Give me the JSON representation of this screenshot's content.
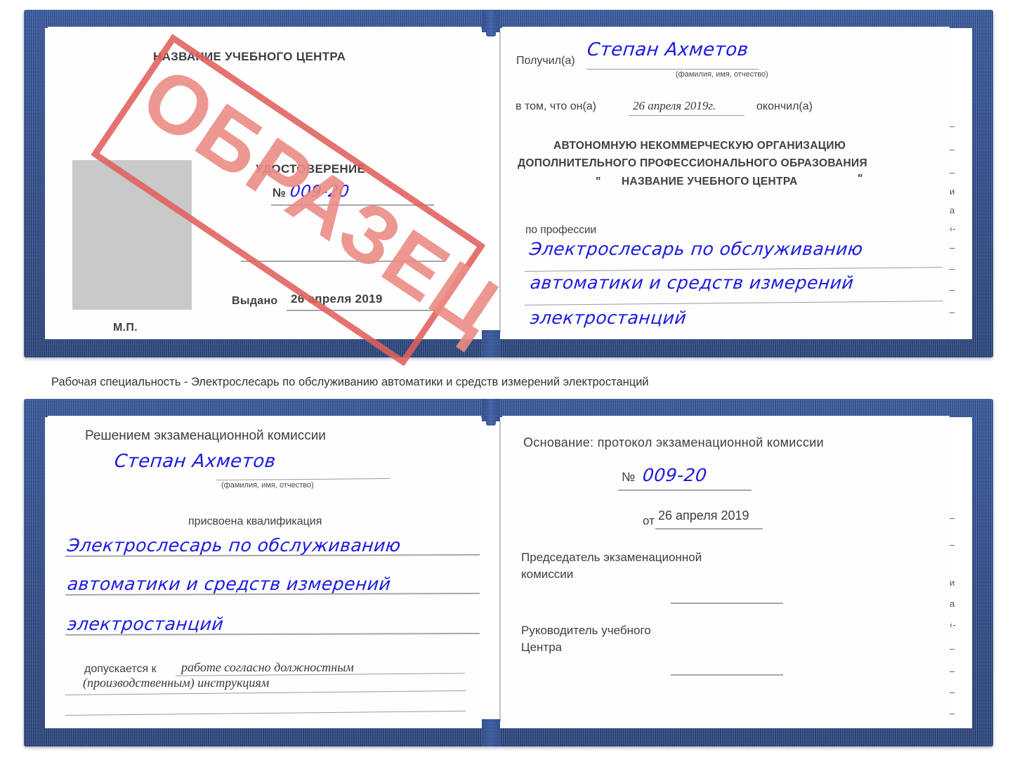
{
  "document": {
    "type": "certificate",
    "language": "ru",
    "colors": {
      "cover_blue": "#2b4a8c",
      "stamp_red": "#e0605c",
      "handwriting_blue": "#1a1ae0",
      "photo_placeholder_grey": "#c9c9c9",
      "rule_grey": "#9b9b9b"
    }
  },
  "stamp": {
    "text": "ОБРАЗЕЦ"
  },
  "cert_top": {
    "left_page": {
      "org_title": "НАЗВАНИЕ УЧЕБНОГО ЦЕНТРА",
      "doc_kind": "УДОСТОВЕРЕНИЕ",
      "number_label": "№",
      "number_value": "009-20",
      "issued_label": "Выдано",
      "issued_value": "26 апреля 2019",
      "seal_label": "М.П."
    },
    "right_page": {
      "received_label": "Получил(а)",
      "received_value": "Степан Ахметов",
      "name_hint": "(фамилия, имя, отчество)",
      "in_that_label": "в том, что он(а)",
      "in_that_value": "26 апреля 2019г.",
      "finished_label": "окончил(а)",
      "org_line1": "АВТОНОМНУЮ НЕКОММЕРЧЕСКУЮ ОРГАНИЗАЦИЮ",
      "org_line2": "ДОПОЛНИТЕЛЬНОГО ПРОФЕССИОНАЛЬНОГО ОБРАЗОВАНИЯ",
      "org_quote_open": "\"",
      "org_line3": "НАЗВАНИЕ УЧЕБНОГО ЦЕНТРА",
      "org_quote_close": "\"",
      "profession_label": "по профессии",
      "profession_line1": "Электрослесарь по обслуживанию",
      "profession_line2": "автоматики и средств измерений",
      "profession_line3": "электростанций"
    }
  },
  "caption": {
    "text": "Рабочая специальность - Электрослесарь по обслуживанию автоматики и средств измерений электростанций"
  },
  "cert_bottom": {
    "left_page": {
      "decision_label": "Решением экзаменационной комиссии",
      "name_value": "Степан Ахметов",
      "name_hint": "(фамилия, имя, отчество)",
      "qualification_label": "присвоена квалификация",
      "qualification_line1": "Электрослесарь по обслуживанию",
      "qualification_line2": "автоматики и средств измерений",
      "qualification_line3": "электростанций",
      "allowed_label": "допускается к",
      "allowed_value_line1": "работе согласно должностным",
      "allowed_value_line2": "(производственным) инструкциям"
    },
    "right_page": {
      "basis_label": "Основание: протокол экзаменационной комиссии",
      "number_label": "№",
      "number_value": "009-20",
      "date_label": "от",
      "date_value": "26 апреля 2019",
      "chair_line1": "Председатель экзаменационной",
      "chair_line2": "комиссии",
      "head_line1": "Руководитель учебного",
      "head_line2": "Центра"
    }
  },
  "edge_fragments": {
    "top": [
      "–",
      "–",
      "–",
      "и",
      "а",
      "‹-",
      "–",
      "–",
      "–",
      "–"
    ],
    "bottom": [
      "–",
      "–",
      "и",
      "а",
      "‹-",
      "–",
      "–",
      "–",
      "–"
    ]
  }
}
